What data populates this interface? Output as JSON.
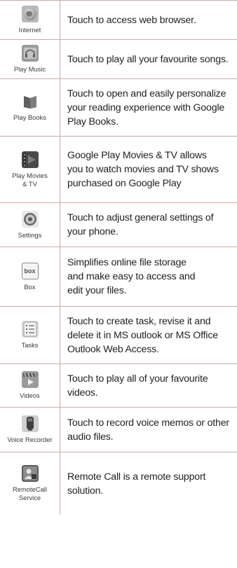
{
  "rows": [
    {
      "label": "Internet",
      "desc": "Touch to access web browser."
    },
    {
      "label": "Play Music",
      "desc": "Touch to play all your favourite songs."
    },
    {
      "label": "Play Books",
      "desc": "Touch to open and easily personalize\nyour reading experience with Google\nPlay Books."
    },
    {
      "label": "Play Movies\n& TV",
      "desc": "Google Play Movies & TV allows\nyou to watch movies and TV shows\npurchased on Google Play"
    },
    {
      "label": "Settings",
      "desc": "Touch to adjust general settings of\nyour phone."
    },
    {
      "label": "Box",
      "desc": "Simplifies online file storage\nand make easy to access and\nedit your files."
    },
    {
      "label": "Tasks",
      "desc": "Touch to create task, revise it and\ndelete it in MS outlook or MS Office\nOutlook Web Access."
    },
    {
      "label": "Videos",
      "desc": "Touch to play all of your favourite\nvideos."
    },
    {
      "label": "Voice Recorder",
      "desc": "Touch to record voice memos or other\naudio files."
    },
    {
      "label": "RemoteCall\nService",
      "desc": "Remote Call  is a remote support\nsolution."
    }
  ],
  "icons": {
    "box_text": "box"
  }
}
